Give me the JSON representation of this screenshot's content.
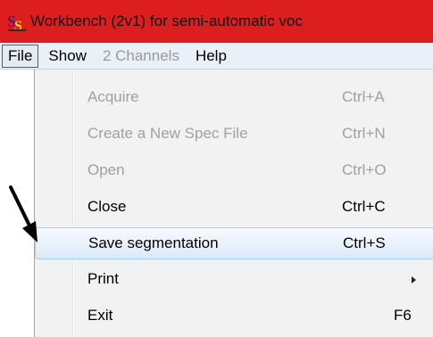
{
  "window": {
    "title": "Workbench (2v1) for semi-automatic voc",
    "titlebar_color": "#dc1e1e",
    "app_icon": "app-logo-icon"
  },
  "menubar": {
    "items": [
      {
        "label": "File",
        "state": "active"
      },
      {
        "label": "Show",
        "state": "enabled"
      },
      {
        "label": "2 Channels",
        "state": "disabled"
      },
      {
        "label": "Help",
        "state": "enabled"
      }
    ]
  },
  "file_menu": {
    "items": [
      {
        "label": "Acquire",
        "shortcut": "Ctrl+A",
        "enabled": false
      },
      {
        "label": "Create a New Spec File",
        "shortcut": "Ctrl+N",
        "enabled": false
      },
      {
        "label": "Open",
        "shortcut": "Ctrl+O",
        "enabled": false
      },
      {
        "label": "Close",
        "shortcut": "Ctrl+C",
        "enabled": true
      },
      {
        "label": "Save segmentation",
        "shortcut": "Ctrl+S",
        "enabled": true,
        "highlighted": true
      },
      {
        "label": "Print",
        "shortcut": "",
        "enabled": true,
        "submenu": true
      },
      {
        "label": "Exit",
        "shortcut": "F6",
        "enabled": true
      }
    ]
  },
  "annotation": {
    "icon": "pointer-arrow-icon",
    "color": "#000000"
  }
}
